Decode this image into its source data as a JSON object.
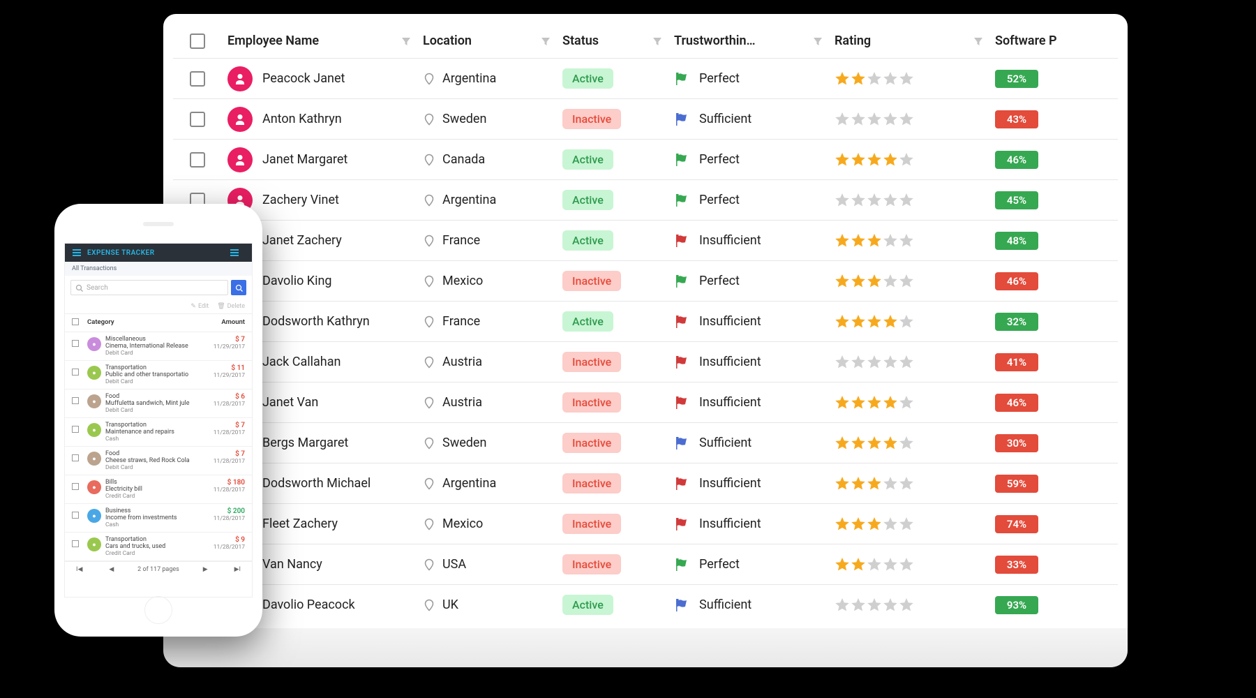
{
  "grid": {
    "columns": [
      "Employee Name",
      "Location",
      "Status",
      "Trustworthin…",
      "Rating",
      "Software P"
    ],
    "rows": [
      {
        "name": "Peacock Janet",
        "location": "Argentina",
        "status": "Active",
        "trust": "Perfect",
        "trustFlag": "green",
        "rating": 2,
        "pct": "52%",
        "pctColor": "green"
      },
      {
        "name": "Anton Kathryn",
        "location": "Sweden",
        "status": "Inactive",
        "trust": "Sufficient",
        "trustFlag": "blue",
        "rating": 0,
        "pct": "43%",
        "pctColor": "red"
      },
      {
        "name": "Janet Margaret",
        "location": "Canada",
        "status": "Active",
        "trust": "Perfect",
        "trustFlag": "green",
        "rating": 4,
        "pct": "46%",
        "pctColor": "green"
      },
      {
        "name": "Zachery Vinet",
        "location": "Argentina",
        "status": "Active",
        "trust": "Perfect",
        "trustFlag": "green",
        "rating": 0,
        "pct": "45%",
        "pctColor": "green"
      },
      {
        "name": "Janet Zachery",
        "location": "France",
        "status": "Active",
        "trust": "Insufficient",
        "trustFlag": "red",
        "rating": 3,
        "pct": "48%",
        "pctColor": "green"
      },
      {
        "name": "Davolio King",
        "location": "Mexico",
        "status": "Inactive",
        "trust": "Perfect",
        "trustFlag": "green",
        "rating": 3,
        "pct": "46%",
        "pctColor": "red"
      },
      {
        "name": "Dodsworth Kathryn",
        "location": "France",
        "status": "Active",
        "trust": "Insufficient",
        "trustFlag": "red",
        "rating": 4,
        "pct": "32%",
        "pctColor": "green"
      },
      {
        "name": "Jack Callahan",
        "location": "Austria",
        "status": "Inactive",
        "trust": "Insufficient",
        "trustFlag": "red",
        "rating": 0,
        "pct": "41%",
        "pctColor": "red"
      },
      {
        "name": "Janet Van",
        "location": "Austria",
        "status": "Inactive",
        "trust": "Insufficient",
        "trustFlag": "red",
        "rating": 4,
        "pct": "46%",
        "pctColor": "red"
      },
      {
        "name": "Bergs Margaret",
        "location": "Sweden",
        "status": "Inactive",
        "trust": "Sufficient",
        "trustFlag": "blue",
        "rating": 4,
        "pct": "30%",
        "pctColor": "red"
      },
      {
        "name": "Dodsworth Michael",
        "location": "Argentina",
        "status": "Inactive",
        "trust": "Insufficient",
        "trustFlag": "red",
        "rating": 3,
        "pct": "59%",
        "pctColor": "red"
      },
      {
        "name": "Fleet Zachery",
        "location": "Mexico",
        "status": "Inactive",
        "trust": "Insufficient",
        "trustFlag": "red",
        "rating": 3,
        "pct": "74%",
        "pctColor": "red"
      },
      {
        "name": "Van Nancy",
        "location": "USA",
        "status": "Inactive",
        "trust": "Perfect",
        "trustFlag": "green",
        "rating": 2,
        "pct": "33%",
        "pctColor": "red"
      },
      {
        "name": "Davolio Peacock",
        "location": "UK",
        "status": "Active",
        "trust": "Sufficient",
        "trustFlag": "blue",
        "rating": 0,
        "pct": "93%",
        "pctColor": "green"
      }
    ]
  },
  "phone": {
    "title": "EXPENSE TRACKER",
    "subtitle": "All Transactions",
    "searchPlaceholder": "Search",
    "toolbar": {
      "edit": "Edit",
      "delete": "Delete"
    },
    "thead": {
      "category": "Category",
      "amount": "Amount"
    },
    "rows": [
      {
        "cat": "Miscellaneous",
        "desc": "Cinema, International Release",
        "pay": "Debit Card",
        "amt": "$ 7",
        "date": "11/29/2017",
        "color": "#c98cdc",
        "sign": "red"
      },
      {
        "cat": "Transportation",
        "desc": "Public and other transportatio",
        "pay": "Debit Card",
        "amt": "$ 11",
        "date": "11/29/2017",
        "color": "#9ac84f",
        "sign": "red"
      },
      {
        "cat": "Food",
        "desc": "Muffuletta sandwich, Mint jule",
        "pay": "Debit Card",
        "amt": "$ 6",
        "date": "11/28/2017",
        "color": "#bba38e",
        "sign": "red"
      },
      {
        "cat": "Transportation",
        "desc": "Maintenance and repairs",
        "pay": "Cash",
        "amt": "$ 7",
        "date": "11/28/2017",
        "color": "#9ac84f",
        "sign": "red"
      },
      {
        "cat": "Food",
        "desc": "Cheese straws, Red Rock Cola",
        "pay": "Debit Card",
        "amt": "$ 7",
        "date": "11/28/2017",
        "color": "#bba38e",
        "sign": "red"
      },
      {
        "cat": "Bills",
        "desc": "Electricity bill",
        "pay": "Credit Card",
        "amt": "$ 180",
        "date": "11/28/2017",
        "color": "#e86b5e",
        "sign": "red"
      },
      {
        "cat": "Business",
        "desc": "Income from investments",
        "pay": "Cash",
        "amt": "$ 200",
        "date": "11/28/2017",
        "color": "#4aa7e6",
        "sign": "green"
      },
      {
        "cat": "Transportation",
        "desc": "Cars and trucks, used",
        "pay": "Credit Card",
        "amt": "$ 9",
        "date": "11/28/2017",
        "color": "#9ac84f",
        "sign": "red"
      }
    ],
    "pager": {
      "label": "2 of 117 pages"
    }
  }
}
